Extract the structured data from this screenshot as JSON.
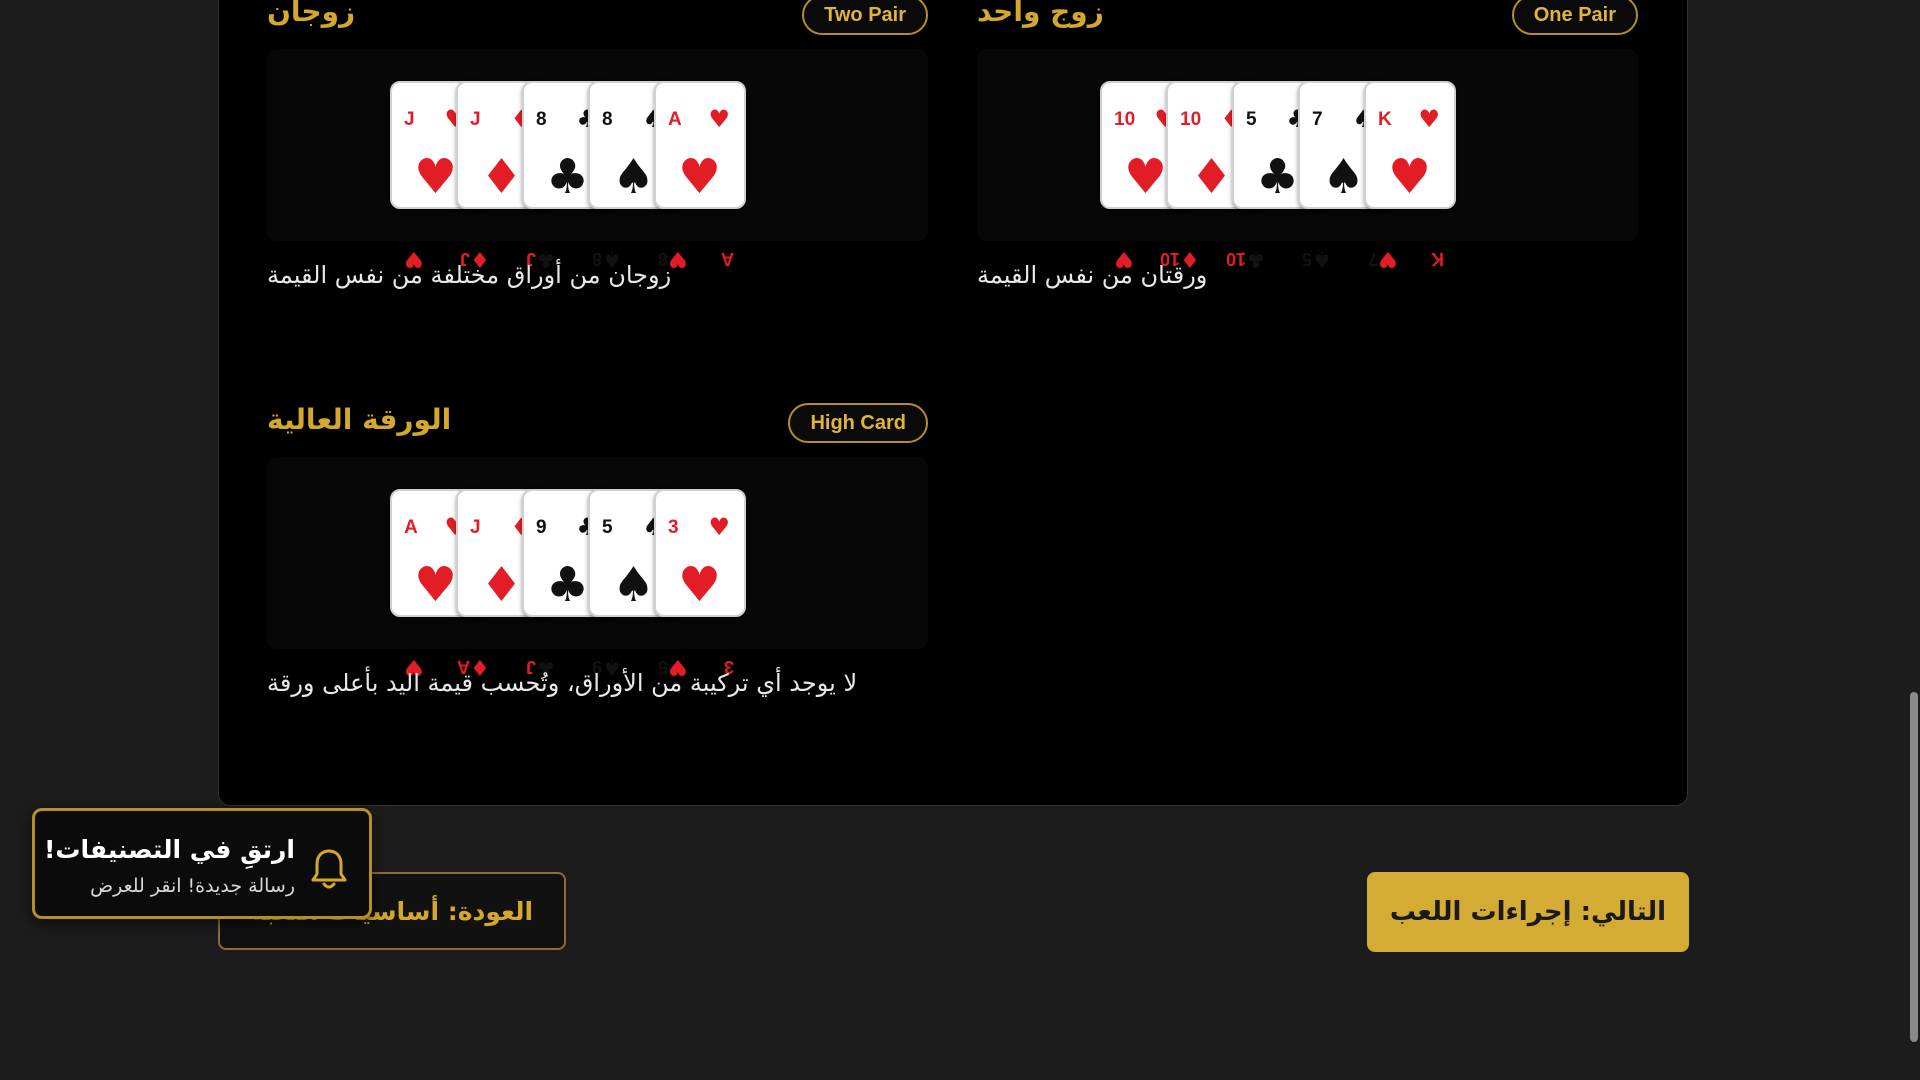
{
  "colors": {
    "accent": "#d4a82a",
    "red_suit": "#e31d26",
    "black_suit": "#111111",
    "background": "#1c1c1c"
  },
  "hands": [
    {
      "title": "زوجان",
      "badge": "Two Pair",
      "description": "زوجان من أوراق مختلفة من نفس القيمة",
      "cards": [
        {
          "rank": "J",
          "suit": "♥",
          "color": "red"
        },
        {
          "rank": "J",
          "suit": "♦",
          "color": "red"
        },
        {
          "rank": "8",
          "suit": "♣",
          "color": "black"
        },
        {
          "rank": "8",
          "suit": "♠",
          "color": "black"
        },
        {
          "rank": "A",
          "suit": "♥",
          "color": "red"
        }
      ]
    },
    {
      "title": "زوج واحد",
      "badge": "One Pair",
      "description": "ورقتان من نفس القيمة",
      "cards": [
        {
          "rank": "10",
          "suit": "♥",
          "color": "red"
        },
        {
          "rank": "10",
          "suit": "♦",
          "color": "red"
        },
        {
          "rank": "5",
          "suit": "♣",
          "color": "black"
        },
        {
          "rank": "7",
          "suit": "♠",
          "color": "black"
        },
        {
          "rank": "K",
          "suit": "♥",
          "color": "red"
        }
      ]
    },
    {
      "title": "الورقة العالية",
      "badge": "High Card",
      "description": "لا يوجد أي تركيبة من الأوراق، وتُحسب قيمة اليد بأعلى ورقة",
      "cards": [
        {
          "rank": "A",
          "suit": "♥",
          "color": "red"
        },
        {
          "rank": "J",
          "suit": "♦",
          "color": "red"
        },
        {
          "rank": "9",
          "suit": "♣",
          "color": "black"
        },
        {
          "rank": "5",
          "suit": "♠",
          "color": "black"
        },
        {
          "rank": "3",
          "suit": "♥",
          "color": "red"
        }
      ]
    }
  ],
  "nav": {
    "back_label": "العودة: أساسيات اللعبة",
    "next_label": "التالي: إجراءات اللعب"
  },
  "toast": {
    "title": "ارتقِ في التصنيفات!",
    "subtitle": "رسالة جديدة! انقر للعرض",
    "icon": "bell-icon"
  }
}
